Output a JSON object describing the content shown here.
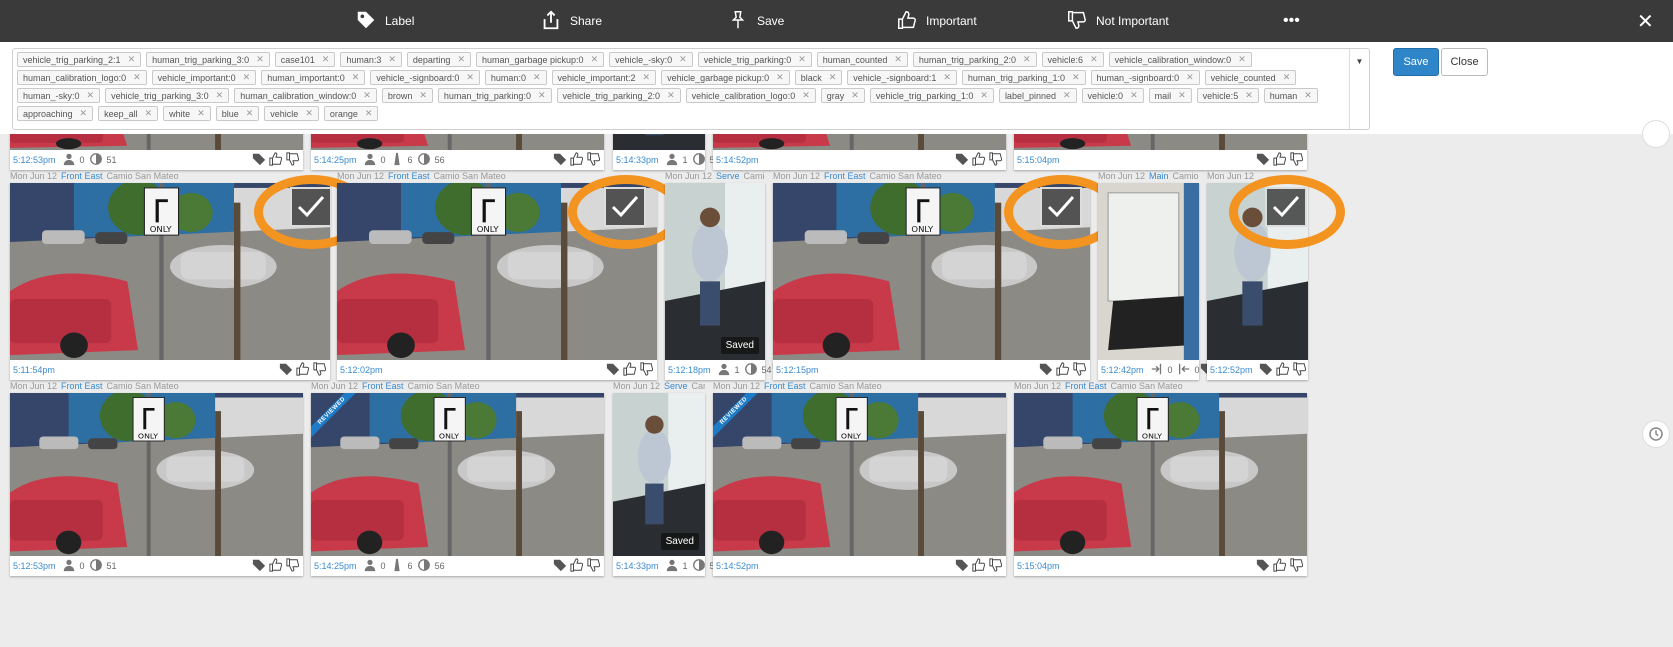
{
  "toolbar": {
    "label": "Label",
    "share": "Share",
    "save": "Save",
    "important": "Important",
    "not_important": "Not Important",
    "more": "•••",
    "close": "✕"
  },
  "tags": [
    "vehicle_trig_parking_2:1",
    "human_trig_parking_3:0",
    "case101",
    "human:3",
    "departing",
    "human_garbage pickup:0",
    "vehicle_-sky:0",
    "vehicle_trig_parking:0",
    "human_counted",
    "human_trig_parking_2:0",
    "vehicle:6",
    "vehicle_calibration_window:0",
    "human_calibration_logo:0",
    "vehicle_important:0",
    "human_important:0",
    "vehicle_-signboard:0",
    "human:0",
    "vehicle_important:2",
    "vehicle_garbage pickup:0",
    "black",
    "vehicle_-signboard:1",
    "human_trig_parking_1:0",
    "human_-signboard:0",
    "vehicle_counted",
    "human_-sky:0",
    "vehicle_trig_parking_3:0",
    "human_calibration_window:0",
    "brown",
    "human_trig_parking:0",
    "vehicle_trig_parking_2:0",
    "vehicle_calibration_logo:0",
    "gray",
    "vehicle_trig_parking_1:0",
    "label_pinned",
    "vehicle:0",
    "mail",
    "vehicle:5",
    "human",
    "approaching",
    "keep_all",
    "white",
    "blue",
    "vehicle",
    "orange"
  ],
  "actions": {
    "save": "Save",
    "close": "Close"
  },
  "colors": {
    "toolbar_bg": "#3a3a3a",
    "accent": "#2e86c9",
    "highlight_ring": "#f39320"
  },
  "row0": [
    {
      "time": "5:12:53pm",
      "people": "0",
      "n": "51"
    },
    {
      "time": "5:14:25pm",
      "people": "0",
      "veh": "6",
      "n": "56"
    },
    {
      "time": "5:14:33pm",
      "people": "1",
      "n": "52"
    },
    {
      "time": "5:14:52pm"
    },
    {
      "time": "5:15:04pm"
    }
  ],
  "row1": [
    {
      "date": "Mon Jun 12",
      "cam": "Front East",
      "loc": "Camio San Mateo",
      "time": "5:11:54pm"
    },
    {
      "date": "Mon Jun 12",
      "cam": "Front East",
      "loc": "Camio San Mateo",
      "time": "5:12:02pm"
    },
    {
      "date": "Mon Jun 12",
      "cam": "Serve",
      "loc": "Camio S",
      "time": "5:12:18pm",
      "people": "1",
      "n": "54",
      "saved": "Saved"
    },
    {
      "date": "Mon Jun 12",
      "cam": "Front East",
      "loc": "Camio San Mateo",
      "time": "5:12:15pm"
    },
    {
      "date": "Mon Jun 12",
      "cam": "Main",
      "loc": "Camio S",
      "time": "5:12:42pm",
      "in": "0",
      "out": "0"
    },
    {
      "date": "Mon Jun 12",
      "cam": "",
      "loc": "",
      "time": "5:12:52pm"
    }
  ],
  "row2": [
    {
      "date": "Mon Jun 12",
      "cam": "Front East",
      "loc": "Camio San Mateo",
      "time": "5:12:53pm",
      "people": "0",
      "n": "51"
    },
    {
      "date": "Mon Jun 12",
      "cam": "Front East",
      "loc": "Camio San Mateo",
      "time": "5:14:25pm",
      "people": "0",
      "veh": "6",
      "n": "56",
      "badge": "REVIEWED"
    },
    {
      "date": "Mon Jun 12",
      "cam": "Serve",
      "loc": "Camio",
      "time": "5:14:33pm",
      "people": "1",
      "n": "52",
      "saved": "Saved"
    },
    {
      "date": "Mon Jun 12",
      "cam": "Front East",
      "loc": "Camio San Mateo",
      "time": "5:14:52pm",
      "badge": "REVIEWED"
    },
    {
      "date": "Mon Jun 12",
      "cam": "Front East",
      "loc": "Camio San Mateo",
      "time": "5:15:04pm"
    }
  ]
}
